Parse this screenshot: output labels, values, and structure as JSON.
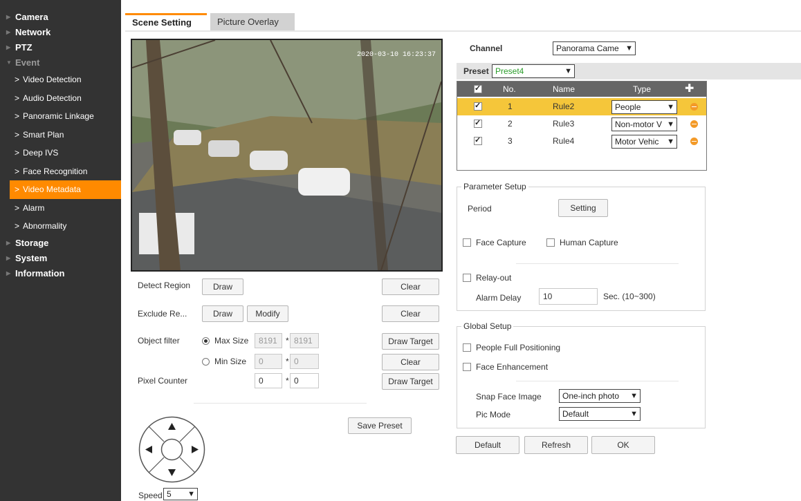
{
  "sidebar": {
    "top_items": [
      {
        "label": "Camera"
      },
      {
        "label": "Network"
      },
      {
        "label": "PTZ"
      },
      {
        "label": "Event"
      },
      {
        "label": "Storage"
      },
      {
        "label": "System"
      },
      {
        "label": "Information"
      }
    ],
    "event_sub_items": [
      {
        "label": "Video Detection"
      },
      {
        "label": "Audio Detection"
      },
      {
        "label": "Panoramic Linkage"
      },
      {
        "label": "Smart Plan"
      },
      {
        "label": "Deep IVS"
      },
      {
        "label": "Face Recognition"
      },
      {
        "label": "Video Metadata"
      },
      {
        "label": "Alarm"
      },
      {
        "label": "Abnormality"
      }
    ]
  },
  "tabs": {
    "scene": "Scene Setting",
    "overlay": "Picture Overlay"
  },
  "video": {
    "timestamp": "2020-03-10 16:23:37"
  },
  "left": {
    "detect_region": "Detect Region",
    "draw": "Draw",
    "clear": "Clear",
    "exclude_region": "Exclude Re...",
    "modify": "Modify",
    "object_filter": "Object filter",
    "max_size": "Max Size",
    "min_size": "Min Size",
    "max_w": "8191",
    "max_h": "8191",
    "min_w": "0",
    "min_h": "0",
    "star": "*",
    "draw_target": "Draw Target",
    "pixel_counter": "Pixel Counter",
    "pc_w": "0",
    "pc_h": "0",
    "save_preset": "Save Preset",
    "speed_label": "Speed",
    "speed_value": "5"
  },
  "right": {
    "channel_label": "Channel",
    "channel_value": "Panorama Came",
    "preset_label": "Preset",
    "preset_value": "Preset4",
    "table_headers": {
      "no": "No.",
      "name": "Name",
      "type": "Type"
    },
    "rules": [
      {
        "no": "1",
        "name": "Rule2",
        "type": "People"
      },
      {
        "no": "2",
        "name": "Rule3",
        "type": "Non-motor V"
      },
      {
        "no": "3",
        "name": "Rule4",
        "type": "Motor Vehic"
      }
    ],
    "param_setup": "Parameter Setup",
    "period": "Period",
    "setting": "Setting",
    "face_capture": "Face Capture",
    "human_capture": "Human Capture",
    "relay_out": "Relay-out",
    "alarm_delay": "Alarm Delay",
    "alarm_delay_value": "10",
    "alarm_delay_unit": "Sec. (10~300)",
    "global_setup": "Global Setup",
    "people_full": "People Full Positioning",
    "face_enh": "Face Enhancement",
    "snap_face": "Snap Face Image",
    "snap_value": "One-inch photo",
    "pic_mode": "Pic Mode",
    "pic_mode_value": "Default"
  },
  "footer": {
    "default": "Default",
    "refresh": "Refresh",
    "ok": "OK"
  },
  "colors": {
    "accent": "#ff8a00",
    "sidebar_bg": "#333333",
    "row_highlight": "#f5c63a"
  }
}
